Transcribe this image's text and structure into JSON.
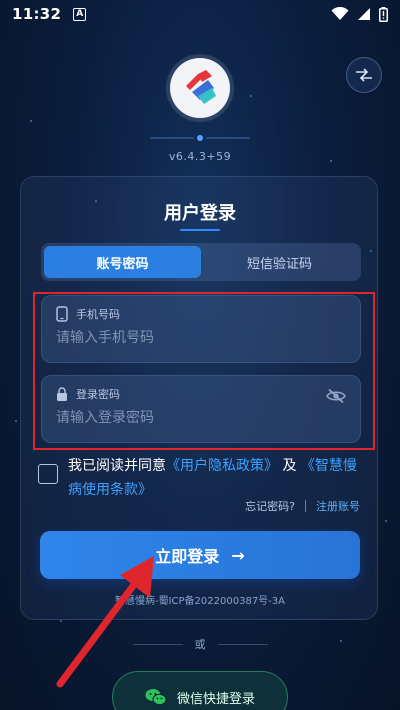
{
  "status_bar": {
    "time": "11:32",
    "badge": "A"
  },
  "app": {
    "version": "v6.4.3+59"
  },
  "login": {
    "title": "用户登录",
    "tabs": [
      {
        "label": "账号密码",
        "active": true
      },
      {
        "label": "短信验证码",
        "active": false
      }
    ],
    "phone": {
      "label": "手机号码",
      "placeholder": "请输入手机号码",
      "value": ""
    },
    "password": {
      "label": "登录密码",
      "placeholder": "请输入登录密码",
      "value": ""
    },
    "agreement": {
      "prefix": "我已阅读并同意",
      "privacy_link": "《用户隐私政策》",
      "and": "及",
      "terms_link": "《智慧慢病使用条款》",
      "checked": false
    },
    "forgot_password": "忘记密码?",
    "register": "注册账号",
    "submit": "立即登录",
    "submit_icon": "→",
    "icp": "智慧慢病-蜀ICP备2022000387号-3A"
  },
  "divider_text": "或",
  "wechat": {
    "label": "微信快捷登录"
  },
  "colors": {
    "accent": "#2b7fe0",
    "link": "#3ea0ff",
    "annotation": "#e0262d"
  }
}
